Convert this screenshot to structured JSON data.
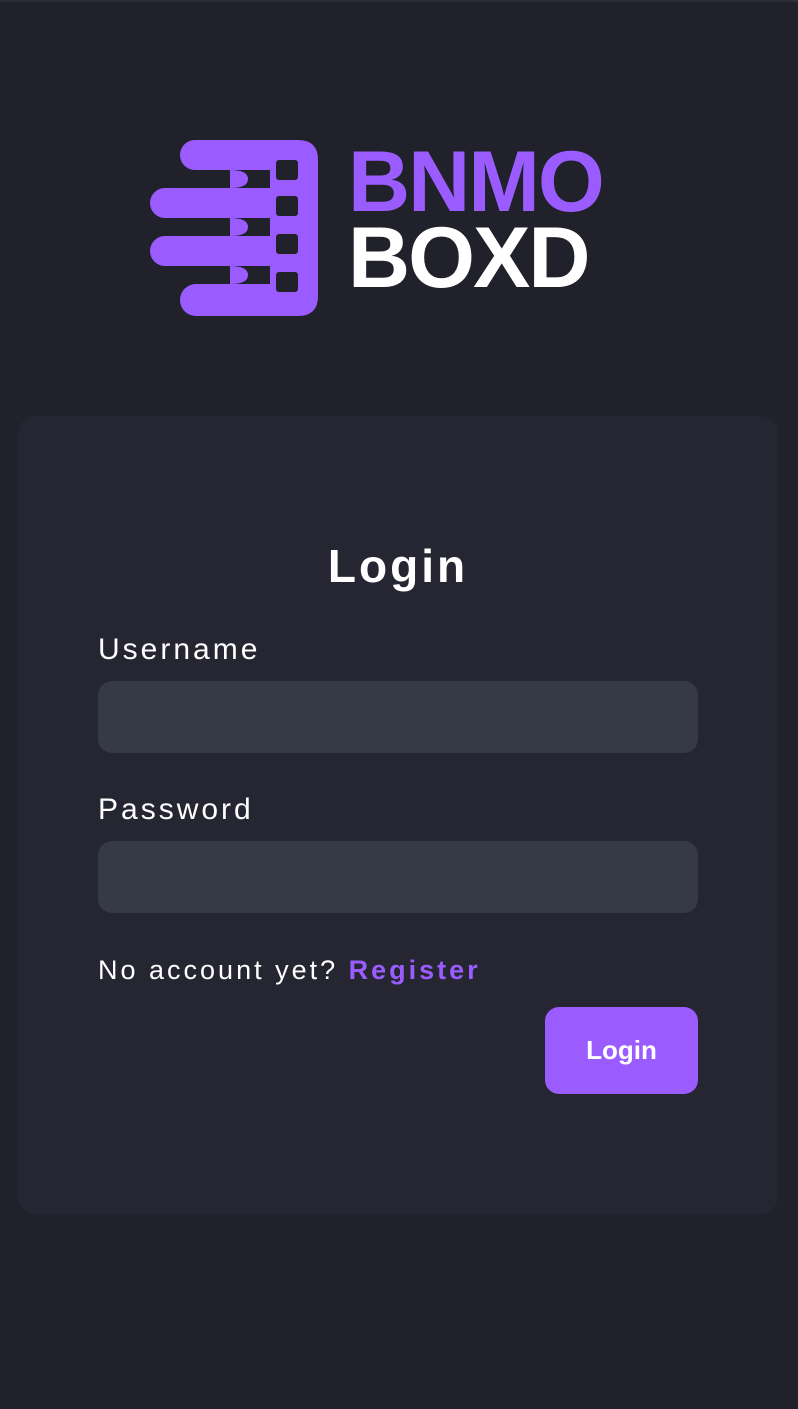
{
  "logo": {
    "line1": "BNMO",
    "line2": "BOXD",
    "accent_color": "#9b5cff",
    "text_color": "#ffffff",
    "mark_icon": "film-strip-speed-icon"
  },
  "login_form": {
    "title": "Login",
    "username_label": "Username",
    "username_value": "",
    "password_label": "Password",
    "password_value": "",
    "register_prompt": "No account yet?",
    "register_link": "Register",
    "submit_label": "Login"
  },
  "colors": {
    "background": "#20212a",
    "card": "#252632",
    "input": "#363946",
    "accent": "#9b5cff"
  }
}
